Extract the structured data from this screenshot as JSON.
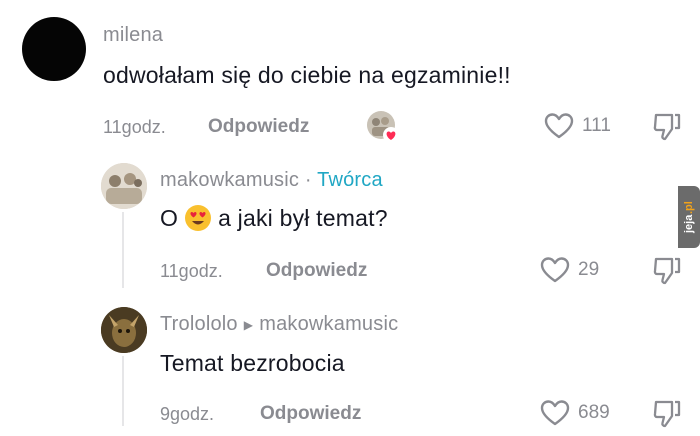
{
  "comments": [
    {
      "username": "milena",
      "text": "odwołałam się do ciebie na egzaminie!!",
      "time": "11godz.",
      "reply_label": "Odpowiedz",
      "likes": "111"
    },
    {
      "username": "makowkamusic",
      "separator": "·",
      "badge": "Twórca",
      "text_before": "O",
      "text_after": "a jaki był temat?",
      "time": "11godz.",
      "reply_label": "Odpowiedz",
      "likes": "29"
    },
    {
      "username": "Trolololo",
      "reply_to": "makowkamusic",
      "text": "Temat bezrobocia",
      "time": "9godz.",
      "reply_label": "Odpowiedz",
      "likes": "689"
    }
  ],
  "watermark": {
    "text": "jeja",
    "suffix": ".pl"
  },
  "colors": {
    "creator_badge": "#20a7c4",
    "liked_heart": "#fe2c55",
    "muted": "#8a8b91"
  },
  "icons": [
    "heart-icon",
    "dislike-icon",
    "creator-liked-avatar-icon",
    "reply-arrow-icon",
    "heart-eyes-emoji"
  ]
}
